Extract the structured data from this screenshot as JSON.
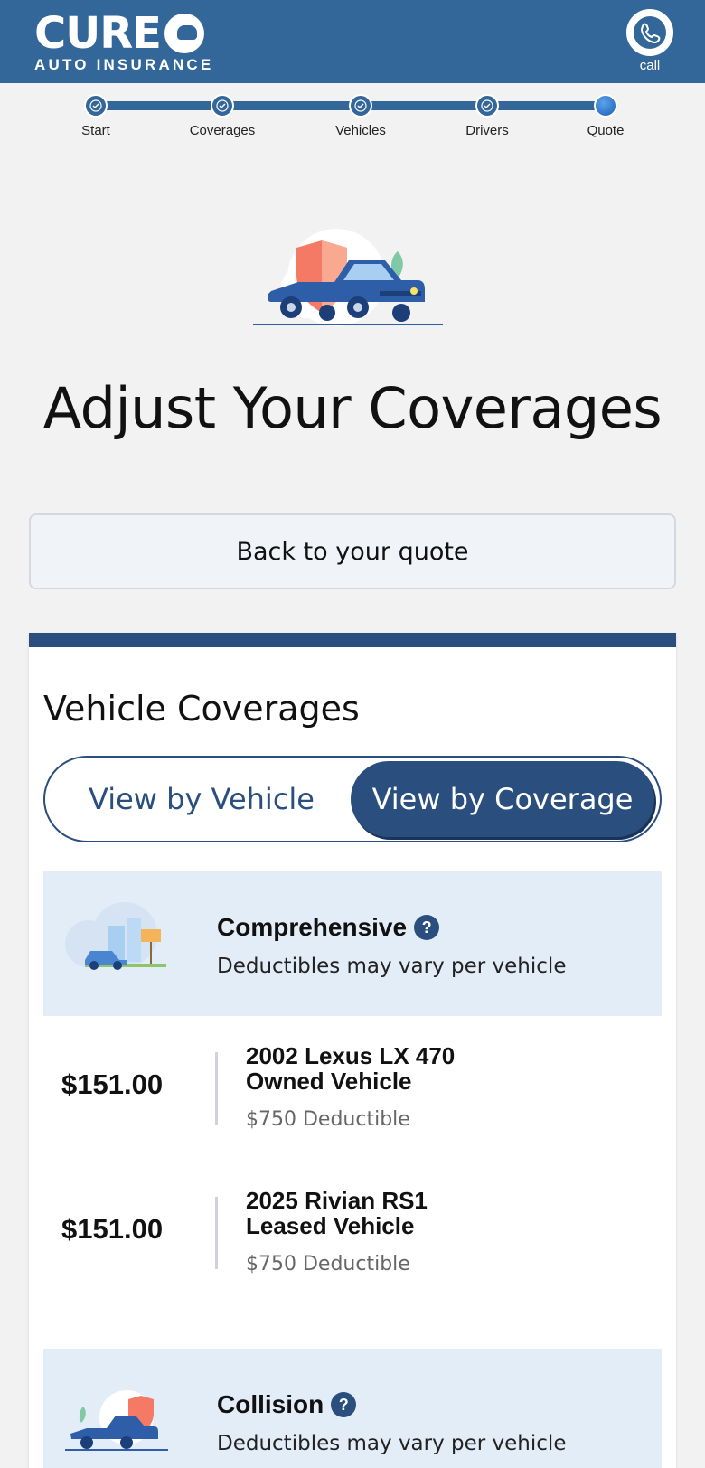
{
  "header": {
    "logo_main": "CURE",
    "logo_sub": "AUTO INSURANCE",
    "call_label": "call"
  },
  "progress": {
    "steps": [
      {
        "label": "Start",
        "status": "complete"
      },
      {
        "label": "Coverages",
        "status": "complete"
      },
      {
        "label": "Vehicles",
        "status": "complete"
      },
      {
        "label": "Drivers",
        "status": "complete"
      },
      {
        "label": "Quote",
        "status": "current"
      }
    ]
  },
  "page": {
    "title": "Adjust Your Coverages",
    "back_button": "Back to your quote"
  },
  "card": {
    "title": "Vehicle Coverages",
    "toggle": {
      "option_vehicle": "View by Vehicle",
      "option_coverage": "View by Coverage",
      "selected": "View by Coverage"
    },
    "coverages": [
      {
        "name": "Comprehensive",
        "note": "Deductibles may vary per vehicle",
        "vehicles": [
          {
            "price": "$151.00",
            "name_line1": "2002 Lexus LX 470",
            "name_line2": "Owned Vehicle",
            "deductible": "$750 Deductible"
          },
          {
            "price": "$151.00",
            "name_line1": "2025 Rivian RS1",
            "name_line2": "Leased Vehicle",
            "deductible": "$750 Deductible"
          }
        ]
      },
      {
        "name": "Collision",
        "note": "Deductibles may vary per vehicle"
      }
    ]
  },
  "colors": {
    "header_bg": "#336699",
    "primary_dark": "#2a4f7f",
    "coverage_bg": "#e3edf8",
    "page_bg": "#f2f2f2"
  },
  "icons": {
    "call": "phone-icon",
    "step_complete": "check-icon",
    "help": "question-icon"
  }
}
